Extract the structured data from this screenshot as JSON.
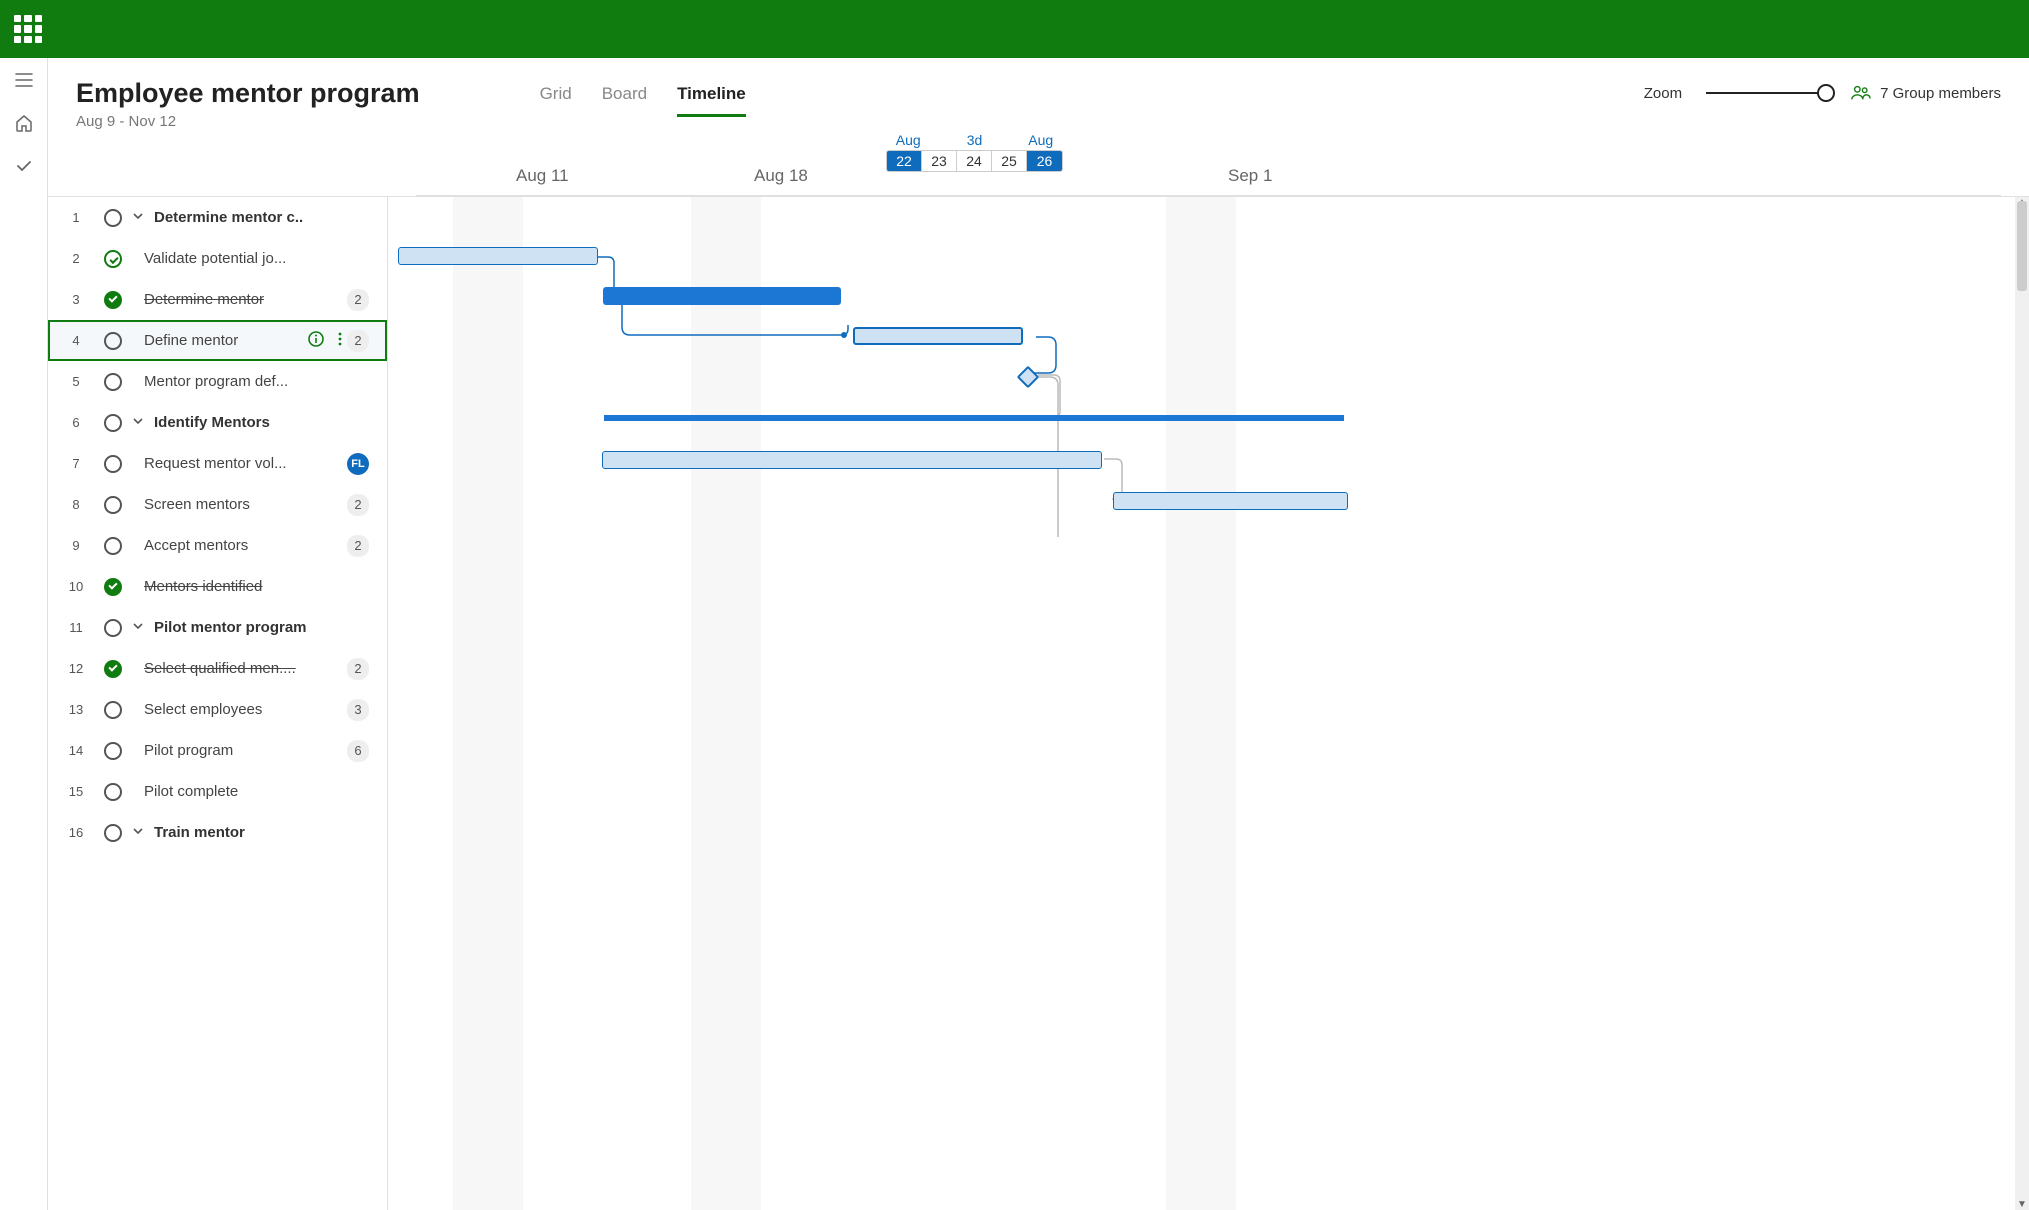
{
  "project": {
    "title": "Employee mentor program",
    "date_range": "Aug 9 - Nov 12"
  },
  "tabs": {
    "grid": "Grid",
    "board": "Board",
    "timeline": "Timeline"
  },
  "right": {
    "zoom_label": "Zoom",
    "members_label": "7 Group members"
  },
  "timeline_header": {
    "tick1": "Aug 11",
    "tick2": "Aug 18",
    "tick3": "Sep  1",
    "range_left_label": "Aug",
    "range_mid_label": "3d",
    "range_right_label": "Aug",
    "cells": [
      "22",
      "23",
      "24",
      "25",
      "26"
    ]
  },
  "tasks": [
    {
      "num": "1",
      "name": "Determine mentor c..",
      "status": "open",
      "group": true
    },
    {
      "num": "2",
      "name": "Validate potential jo...",
      "status": "done-ring"
    },
    {
      "num": "3",
      "name": "Determine mentor",
      "status": "done",
      "struck": true,
      "badge": "2"
    },
    {
      "num": "4",
      "name": "Define mentor",
      "status": "open",
      "selected": true,
      "info": true,
      "more": true,
      "badge": "2"
    },
    {
      "num": "5",
      "name": "Mentor program def...",
      "status": "open"
    },
    {
      "num": "6",
      "name": "Identify Mentors",
      "status": "open",
      "group": true
    },
    {
      "num": "7",
      "name": "Request mentor vol...",
      "status": "open",
      "avatar": "FL"
    },
    {
      "num": "8",
      "name": "Screen mentors",
      "status": "open",
      "badge": "2"
    },
    {
      "num": "9",
      "name": "Accept mentors",
      "status": "open",
      "badge": "2"
    },
    {
      "num": "10",
      "name": "Mentors identified",
      "status": "done",
      "struck": true
    },
    {
      "num": "11",
      "name": "Pilot mentor  program",
      "status": "open",
      "group": true
    },
    {
      "num": "12",
      "name": "Select qualified men....",
      "status": "done",
      "struck": true,
      "badge": "2"
    },
    {
      "num": "13",
      "name": "Select employees",
      "status": "open",
      "badge": "3"
    },
    {
      "num": "14",
      "name": "Pilot program",
      "status": "open",
      "badge": "6"
    },
    {
      "num": "15",
      "name": "Pilot complete",
      "status": "open"
    },
    {
      "num": "16",
      "name": "Train mentor",
      "status": "open",
      "group": true
    }
  ]
}
